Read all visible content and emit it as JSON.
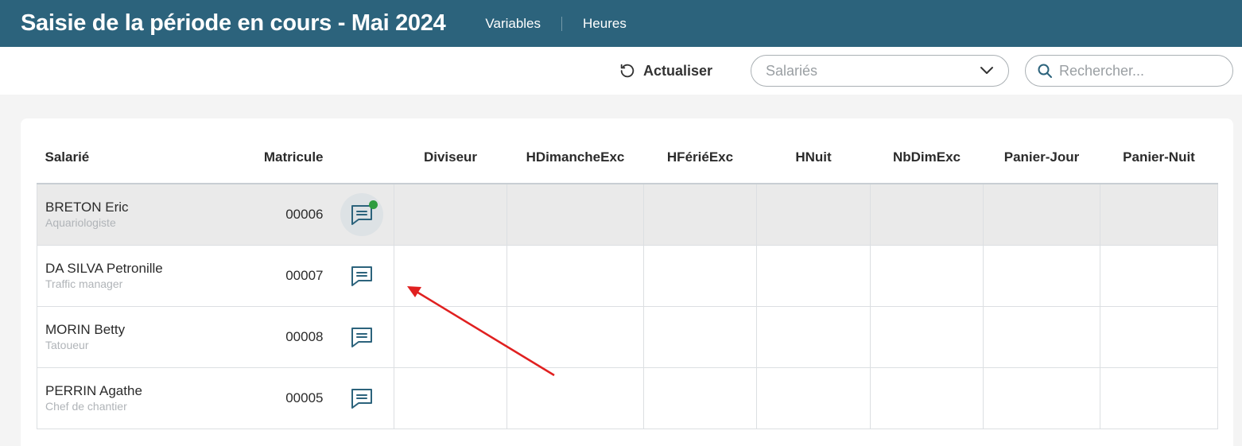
{
  "header": {
    "title": "Saisie de la période en cours - Mai 2024",
    "nav": [
      "Variables",
      "Heures"
    ]
  },
  "toolbar": {
    "refresh_label": "Actualiser",
    "employees_select_placeholder": "Salariés",
    "search_placeholder": "Rechercher..."
  },
  "table": {
    "columns": [
      "Salarié",
      "Matricule",
      "Diviseur",
      "HDimancheExc",
      "HFériéExc",
      "HNuit",
      "NbDimExc",
      "Panier-Jour",
      "Panier-Nuit"
    ],
    "rows": [
      {
        "name": "BRETON Eric",
        "role": "Aquariologiste",
        "matricule": "00006",
        "selected": true,
        "has_comment": true
      },
      {
        "name": "DA SILVA Petronille",
        "role": "Traffic manager",
        "matricule": "00007",
        "selected": false,
        "has_comment": false
      },
      {
        "name": "MORIN Betty",
        "role": "Tatoueur",
        "matricule": "00008",
        "selected": false,
        "has_comment": false
      },
      {
        "name": "PERRIN Agathe",
        "role": "Chef de chantier",
        "matricule": "00005",
        "selected": false,
        "has_comment": false
      }
    ]
  },
  "colors": {
    "topbar": "#2c637c",
    "icon": "#2c637c",
    "comment_dot": "#2e9c3f",
    "annotation_arrow": "#e02020"
  }
}
